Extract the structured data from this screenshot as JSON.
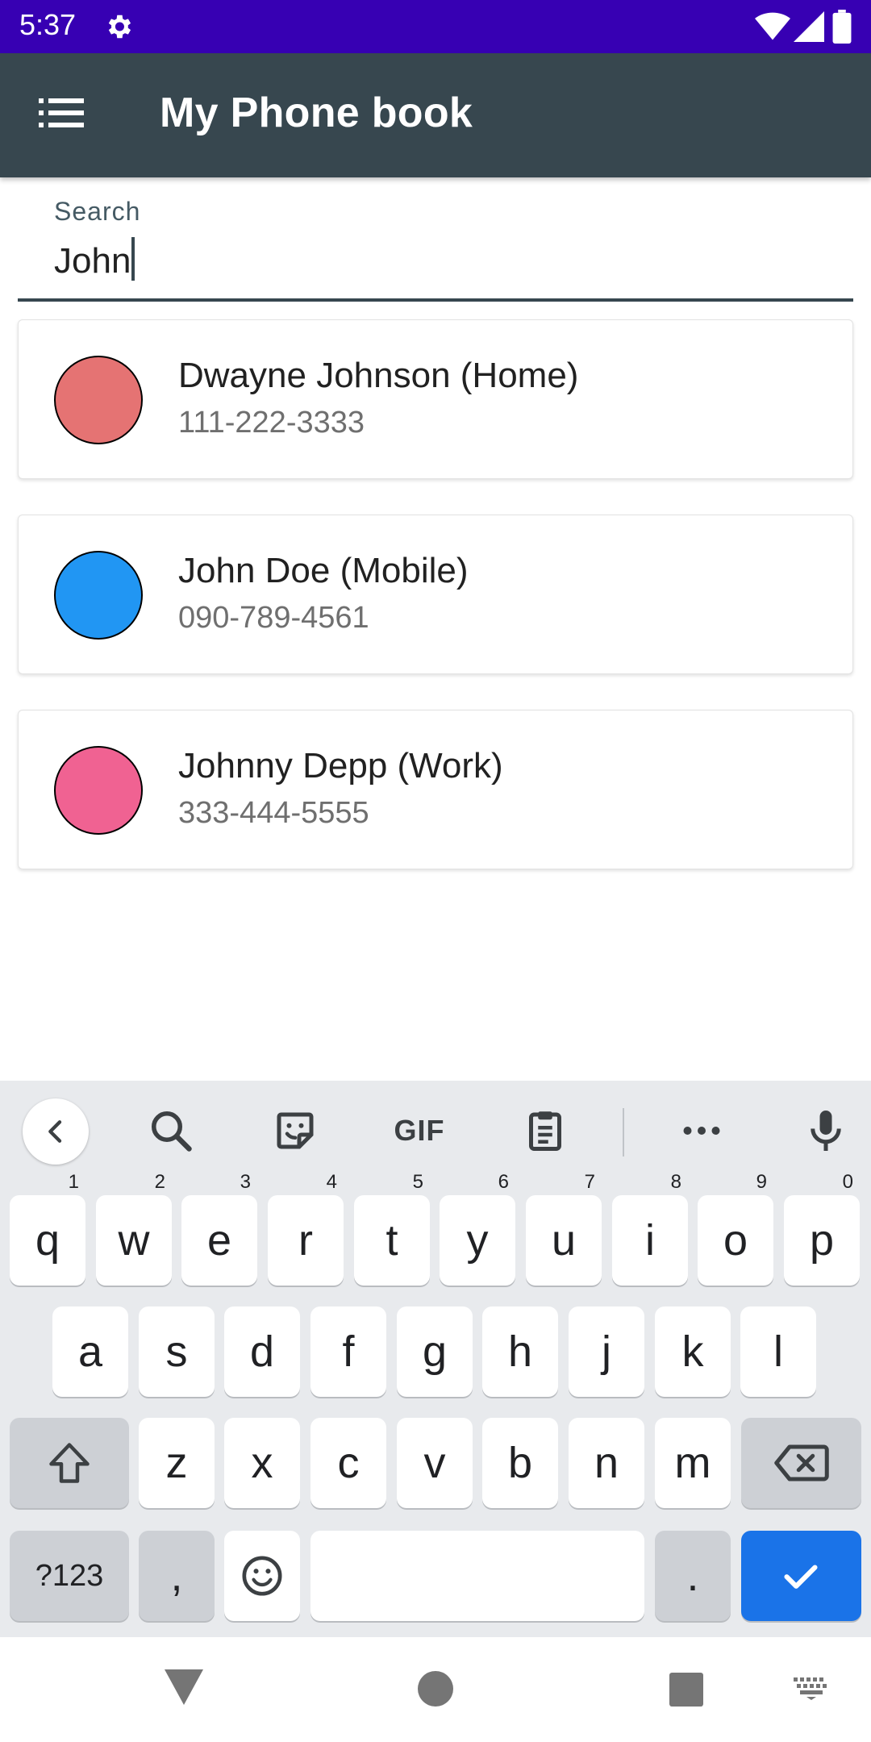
{
  "status_bar": {
    "time": "5:37",
    "icons": [
      "settings-gear-icon",
      "wifi-icon",
      "cell-signal-icon",
      "battery-icon"
    ],
    "background": "#3700b3"
  },
  "app_bar": {
    "title": "My Phone book",
    "menu_icon": "list-menu-icon",
    "background": "#37474f"
  },
  "search": {
    "label": "Search",
    "value": "John"
  },
  "contacts": [
    {
      "name": "Dwayne Johnson (Home)",
      "phone": "111-222-3333",
      "avatar_color": "#e57373"
    },
    {
      "name": "John Doe (Mobile)",
      "phone": "090-789-4561",
      "avatar_color": "#2196f3"
    },
    {
      "name": "Johnny Depp (Work)",
      "phone": "333-444-5555",
      "avatar_color": "#f06292"
    }
  ],
  "keyboard": {
    "toolbar": [
      "back-chevron-icon",
      "search-icon",
      "sticker-icon",
      "gif-icon",
      "clipboard-icon",
      "more-icon",
      "microphone-icon"
    ],
    "gif_label": "GIF",
    "row1": [
      {
        "key": "q",
        "hint": "1"
      },
      {
        "key": "w",
        "hint": "2"
      },
      {
        "key": "e",
        "hint": "3"
      },
      {
        "key": "r",
        "hint": "4"
      },
      {
        "key": "t",
        "hint": "5"
      },
      {
        "key": "y",
        "hint": "6"
      },
      {
        "key": "u",
        "hint": "7"
      },
      {
        "key": "i",
        "hint": "8"
      },
      {
        "key": "o",
        "hint": "9"
      },
      {
        "key": "p",
        "hint": "0"
      }
    ],
    "row2": [
      "a",
      "s",
      "d",
      "f",
      "g",
      "h",
      "j",
      "k",
      "l"
    ],
    "row3": [
      "z",
      "x",
      "c",
      "v",
      "b",
      "n",
      "m"
    ],
    "symbols_label": "?123",
    "comma_label": ",",
    "period_label": ".",
    "accent": "#1a73e8"
  },
  "nav_bar": {
    "icons": [
      "back-triangle-icon",
      "home-circle-icon",
      "recents-square-icon",
      "keyboard-switch-icon"
    ]
  }
}
